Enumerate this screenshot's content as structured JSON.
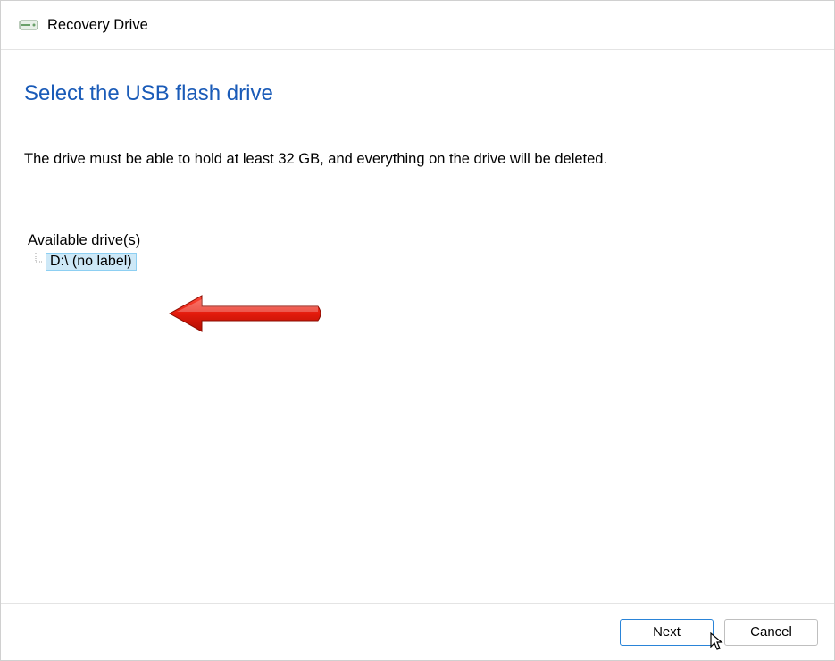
{
  "titlebar": {
    "title": "Recovery Drive"
  },
  "main": {
    "heading": "Select the USB flash drive",
    "description": "The drive must be able to hold at least 32 GB, and everything on the drive will be deleted.",
    "available_label": "Available drive(s)",
    "drives": [
      {
        "label": "D:\\ (no label)",
        "selected": true
      }
    ]
  },
  "footer": {
    "next_label": "Next",
    "cancel_label": "Cancel"
  }
}
